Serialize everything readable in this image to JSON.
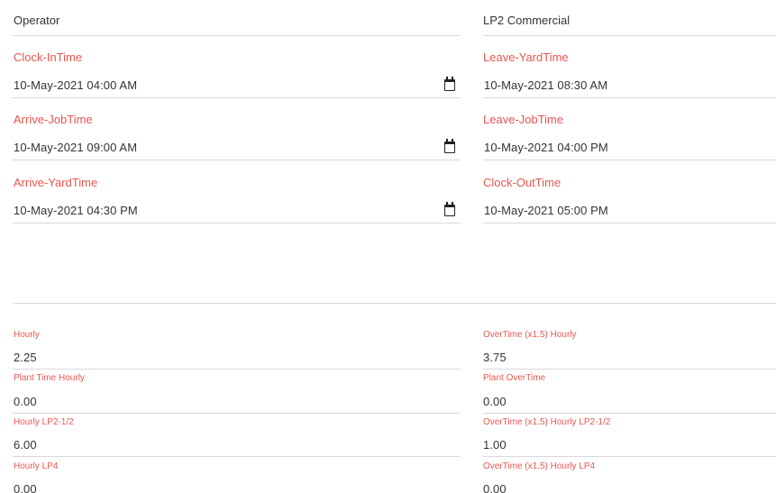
{
  "top": {
    "operator_value": "Operator",
    "commercial_value": "LP2 Commercial"
  },
  "times": {
    "clock_in_label": "Clock-InTime",
    "clock_in_value": "10-May-2021 04:00 AM",
    "arrive_job_label": "Arrive-JobTime",
    "arrive_job_value": "10-May-2021 09:00 AM",
    "arrive_yard_label": "Arrive-YardTime",
    "arrive_yard_value": "10-May-2021 04:30 PM",
    "leave_yard_label": "Leave-YardTime",
    "leave_yard_value": "10-May-2021 08:30 AM",
    "leave_job_label": "Leave-JobTime",
    "leave_job_value": "10-May-2021 04:00 PM",
    "clock_out_label": "Clock-OutTime",
    "clock_out_value": "10-May-2021 05:00 PM"
  },
  "hours": {
    "hourly_label": "Hourly",
    "hourly_value": "2.25",
    "plant_hourly_label": "Plant Time Hourly",
    "plant_hourly_value": "0.00",
    "hourly_lp2_label": "Hourly LP2-1/2",
    "hourly_lp2_value": "6.00",
    "hourly_lp4_label": "Hourly LP4",
    "hourly_lp4_value": "0.00",
    "ot_hourly_label": "OverTime (x1.5) Hourly",
    "ot_hourly_value": "3.75",
    "plant_ot_label": "Plant OverTime",
    "plant_ot_value": "0.00",
    "ot_lp2_label": "OverTime (x1.5) Hourly LP2-1/2",
    "ot_lp2_value": "1.00",
    "ot_lp4_label": "OverTime (x1.5) Hourly LP4",
    "ot_lp4_value": "0.00"
  },
  "icons": {
    "calendar": "calendar-icon"
  }
}
